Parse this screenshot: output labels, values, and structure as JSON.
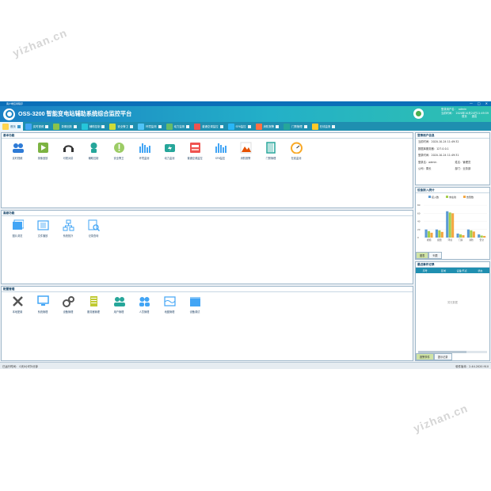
{
  "watermarks": [
    "yizhan.cn",
    "yizhan.cn"
  ],
  "window": {
    "titlebar_text": "客户端应用程序",
    "controls": [
      "—",
      "□",
      "✕"
    ]
  },
  "header": {
    "title": "OSS-3200 智能变电站辅助系统综合监控平台",
    "user_label": "登录用户名：",
    "user_value": "admin",
    "time_label": "当前时间：",
    "time_value": "2020年10月24日11:49:59",
    "link_home": "首页",
    "link_logout": "退出"
  },
  "tabs": [
    {
      "label": "首页",
      "active": true,
      "color": "#ffd54f"
    },
    {
      "label": "实时视频",
      "color": "#42a5f5"
    },
    {
      "label": "录像回放",
      "color": "#8bc34a"
    },
    {
      "label": "辅助控制",
      "color": "#26c6da"
    },
    {
      "label": "安全警卫",
      "color": "#cddc39"
    },
    {
      "label": "环境监测",
      "color": "#4fc3f7"
    },
    {
      "label": "动力监测",
      "color": "#66bb6a"
    },
    {
      "label": "普通空调监控",
      "color": "#ef5350"
    },
    {
      "label": "SF6监控",
      "color": "#29b6f6"
    },
    {
      "label": "消防报警",
      "color": "#ff7043"
    },
    {
      "label": "门禁管理",
      "color": "#26a69a"
    },
    {
      "label": "在线监测",
      "color": "#ffca28"
    }
  ],
  "sections": {
    "basic": {
      "title": "基本功能",
      "items": [
        {
          "label": "实时视频",
          "icon": "users-icon",
          "color": "#2e7bd6"
        },
        {
          "label": "录像回放",
          "icon": "play-icon",
          "color": "#7cb342"
        },
        {
          "label": "可视对讲",
          "icon": "headset-icon",
          "color": "#333333"
        },
        {
          "label": "辅助控制",
          "icon": "robot-icon",
          "color": "#26a69a"
        },
        {
          "label": "安全警卫",
          "icon": "alert-icon",
          "color": "#9ccc65"
        },
        {
          "label": "环境监测",
          "icon": "bars-icon",
          "color": "#42a5f5"
        },
        {
          "label": "动力监测",
          "icon": "power-icon",
          "color": "#26a69a"
        },
        {
          "label": "普通空调监控",
          "icon": "aircon-icon",
          "color": "#ef5350"
        },
        {
          "label": "SF6监控",
          "icon": "bars-icon",
          "color": "#42a5f5"
        },
        {
          "label": "消防报警",
          "icon": "fire-icon",
          "color": "#e65100"
        },
        {
          "label": "门禁管理",
          "icon": "door-icon",
          "color": "#26a69a"
        },
        {
          "label": "在线监测",
          "icon": "gauge-icon",
          "color": "#f9a825"
        }
      ]
    },
    "advanced": {
      "title": "高级功能",
      "items": [
        {
          "label": "图片浏览",
          "icon": "gallery-icon",
          "color": "#42a5f5"
        },
        {
          "label": "文件播放",
          "icon": "film-icon",
          "color": "#42a5f5"
        },
        {
          "label": "系统拓扑",
          "icon": "topology-icon",
          "color": "#42a5f5"
        },
        {
          "label": "记录查询",
          "icon": "search-doc-icon",
          "color": "#42a5f5"
        }
      ]
    },
    "config": {
      "title": "配置管理",
      "items": [
        {
          "label": "本地配置",
          "icon": "tools-icon",
          "color": "#555555"
        },
        {
          "label": "系统管理",
          "icon": "monitor-icon",
          "color": "#42a5f5"
        },
        {
          "label": "设备管理",
          "icon": "gears-icon",
          "color": "#555555"
        },
        {
          "label": "服务器管理",
          "icon": "server-icon",
          "color": "#c0ca33"
        },
        {
          "label": "用户管理",
          "icon": "users-icon",
          "color": "#26a69a"
        },
        {
          "label": "人员管理",
          "icon": "group-icon",
          "color": "#42a5f5"
        },
        {
          "label": "地图管理",
          "icon": "map-icon",
          "color": "#42a5f5"
        },
        {
          "label": "设备调试",
          "icon": "box-icon",
          "color": "#42a5f5"
        }
      ]
    }
  },
  "login_info": {
    "title": "登录用户信息",
    "current_time": "当前时间：2020-10-24 11:49:32",
    "server": "数据库服务器：127.0.0.1",
    "login_time": "登录时间：2020-10-24 11:49:31",
    "login_user": "登录名：admin",
    "name": "姓名：管理员",
    "company": "公司：周长",
    "dept": "部门：业务部"
  },
  "device_stats": {
    "title": "设备接入统计",
    "tabs": [
      "图表",
      "列表"
    ],
    "chart_data": {
      "type": "bar",
      "categories": [
        "视频",
        "报警",
        "环境",
        "门禁",
        "消防",
        "安全"
      ],
      "series": [
        {
          "name": "接入数",
          "color": "#5b9bd5",
          "values": [
            20,
            20,
            65,
            10,
            20,
            8
          ]
        },
        {
          "name": "未在线",
          "color": "#a5cf4c",
          "values": [
            16,
            18,
            62,
            8,
            18,
            5
          ]
        },
        {
          "name": "告警数",
          "color": "#f4a742",
          "values": [
            12,
            14,
            60,
            6,
            15,
            4
          ]
        }
      ],
      "ylim": [
        0,
        90
      ],
      "yticks": [
        "80",
        "60",
        "40",
        "20",
        "0"
      ]
    }
  },
  "events": {
    "title": "最近事件记录",
    "columns": [
      "序号",
      "区域",
      "设备/节点",
      "状态"
    ],
    "empty_text": "暂无数据",
    "tabs": [
      "报警事件",
      "提示记录"
    ]
  },
  "statusbar": {
    "runtime": "已运行时间：  0天0小时5分钟",
    "version": "软件版本：2.44.2020.910"
  }
}
